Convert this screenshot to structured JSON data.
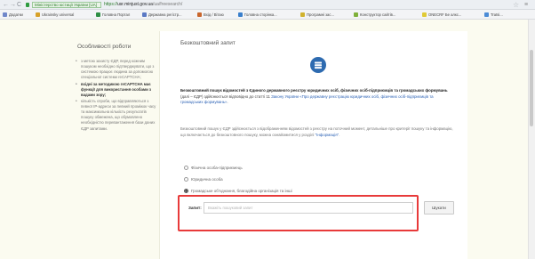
{
  "browser": {
    "back_glyph": "←",
    "forward_glyph": "→",
    "reload_glyph": "C",
    "secure_label": "Міністерство юстиції України [UA]",
    "url_scheme": "https://",
    "url_host": "usr.minjust.gov.ua",
    "url_path": "/ua/freesearch/",
    "star_glyph": "☆",
    "menu_glyph": "≡"
  },
  "bookmarks": [
    {
      "label": "Додатки",
      "color": "#6f86c9"
    },
    {
      "label": "Ukrainsky universal",
      "color": "#d7a12a"
    },
    {
      "label": "Головна Портал",
      "color": "#2f8f45"
    },
    {
      "label": "Державна регістр...",
      "color": "#5b79c4"
    },
    {
      "label": "Вхід / Вітаю",
      "color": "#c9662d"
    },
    {
      "label": "Головна сторінка...",
      "color": "#3a7fcc"
    },
    {
      "label": "Програмні зас...",
      "color": "#d0b22e"
    },
    {
      "label": "Конструктор сайтів...",
      "color": "#7fb03a"
    },
    {
      "label": "ONECRF Бе алкс...",
      "color": "#e0ca36"
    },
    {
      "label": "Tratsi...",
      "color": "#4b8bd6"
    }
  ],
  "sidebar": {
    "title": "Особливості роботи",
    "items": [
      {
        "text": "з метою захисту ЄДР, перед кожним пошуком необхідно підтверджувати, що з системою працює людина за допомогою спеціальної системи reCAPTCHA;",
        "bold": false
      },
      {
        "text": "вхідні за методикою reCAPTCHA має функції для використання особами з вадами зору;",
        "bold": true
      },
      {
        "text": "кількість спроби, що відправляються з певної IP-адреси за певний проміжок часу та максимальна кількість результатів пошуку обмежена, що обумовлено необхідністю перевантаження бази даних ЄДР запитами.",
        "bold": false
      }
    ]
  },
  "main": {
    "title": "Безкоштовний запит",
    "db_icon": "database-icon",
    "intro_bold": "Безкоштовний пошук відомостей з Єдиного державного реєстру юридичних осіб, фізичних осіб-підприємців та громадських формувань",
    "intro_rest": " (далі – ЄДР) здійснюється відповідно до статті 11 ",
    "intro_link": "Закону України «Про державну реєстрацію юридичних осіб, фізичних осіб-підприємців та громадських формувань»",
    "intro_end": ".",
    "note_text": "Безкоштовний пошук у ЄДР здійснюється з відображенням відомостей з реєстру на поточний момент, детальніше про критерії пошуку та інформацію, що включається до безкоштовного пошуку, можна ознайомитися у розділі ",
    "note_link": "\"Інформація\"",
    "note_end": ".",
    "radios": [
      {
        "label": "Фізична особа-підприємець",
        "checked": false
      },
      {
        "label": "Юридична особа",
        "checked": false
      },
      {
        "label": "Громадське об'єднання, благодійна організація та інші",
        "checked": true
      }
    ],
    "search": {
      "label": "Запит:",
      "placeholder": "Вкажіть пошуковий запит",
      "value": "",
      "button_label": "Шукати"
    }
  },
  "colors": {
    "highlight": "#e83a3a",
    "link": "#2f64b6",
    "icon_blue": "#2e6bb0"
  }
}
